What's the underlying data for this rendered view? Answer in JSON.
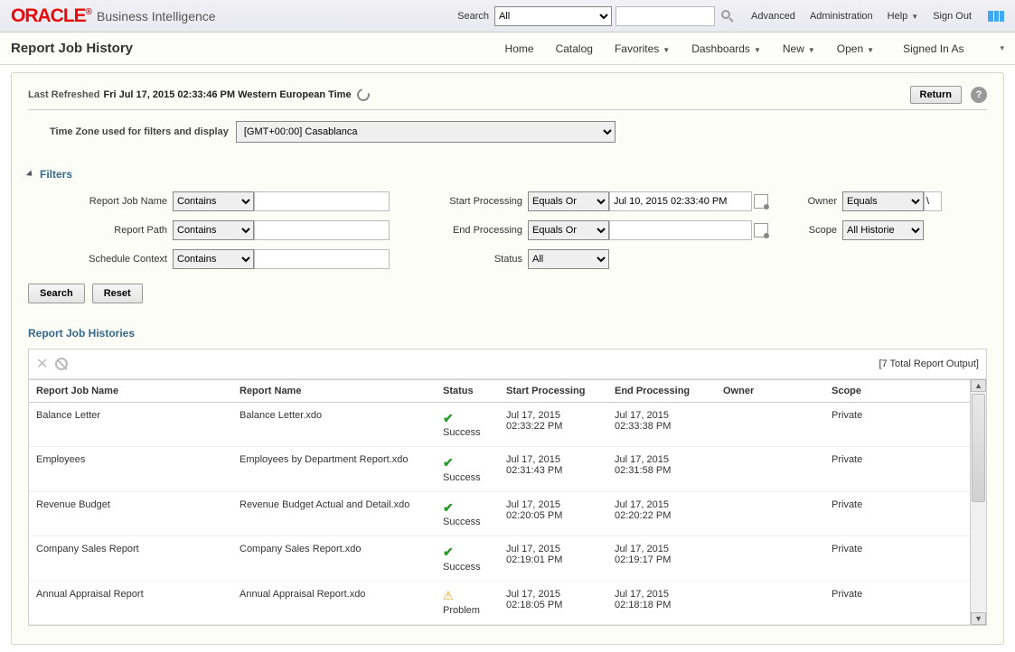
{
  "brand": {
    "oracle": "ORACLE",
    "reg": "®",
    "bi": "Business Intelligence"
  },
  "topbar": {
    "search_label": "Search",
    "search_scope": "All",
    "advanced": "Advanced",
    "administration": "Administration",
    "help": "Help",
    "signout": "Sign Out"
  },
  "subnav": {
    "page_title": "Report Job History",
    "home": "Home",
    "catalog": "Catalog",
    "favorites": "Favorites",
    "dashboards": "Dashboards",
    "new": "New",
    "open": "Open",
    "signed_in": "Signed In As"
  },
  "panel": {
    "last_refreshed_label": "Last Refreshed",
    "last_refreshed_value": "Fri Jul 17, 2015 02:33:46 PM Western European Time",
    "return": "Return",
    "tz_label": "Time Zone used for filters and display",
    "tz_value": "[GMT+00:00] Casablanca",
    "filters_title": "Filters"
  },
  "filters": {
    "report_job_name_label": "Report Job Name",
    "report_path_label": "Report Path",
    "schedule_context_label": "Schedule Context",
    "start_processing_label": "Start Processing",
    "end_processing_label": "End Processing",
    "status_label": "Status",
    "owner_label": "Owner",
    "scope_label": "Scope",
    "contains": "Contains",
    "equals_or": "Equals Or",
    "equals": "Equals",
    "status_all": "All",
    "scope_value": "All Historie",
    "start_value": "Jul 10, 2015 02:33:40 PM",
    "end_value": "",
    "owner_value": "\\",
    "search_btn": "Search",
    "reset_btn": "Reset"
  },
  "histories": {
    "title": "Report Job Histories",
    "total": "[7 Total Report Output]",
    "columns": {
      "job_name": "Report Job Name",
      "report_name": "Report Name",
      "status": "Status",
      "start": "Start Processing",
      "end": "End Processing",
      "owner": "Owner",
      "scope": "Scope"
    },
    "status_success": "Success",
    "status_problem": "Problem",
    "rows": [
      {
        "job": "Balance Letter",
        "report": "Balance Letter.xdo",
        "status": "Success",
        "start1": "Jul 17, 2015",
        "start2": "02:33:22 PM",
        "end1": "Jul 17, 2015",
        "end2": "02:33:38 PM",
        "owner": "",
        "scope": "Private"
      },
      {
        "job": "Employees",
        "report": "Employees by Department Report.xdo",
        "status": "Success",
        "start1": "Jul 17, 2015",
        "start2": "02:31:43 PM",
        "end1": "Jul 17, 2015",
        "end2": "02:31:58 PM",
        "owner": "",
        "scope": "Private"
      },
      {
        "job": "Revenue Budget",
        "report": "Revenue Budget Actual and Detail.xdo",
        "status": "Success",
        "start1": "Jul 17, 2015",
        "start2": "02:20:05 PM",
        "end1": "Jul 17, 2015",
        "end2": "02:20:22 PM",
        "owner": "",
        "scope": "Private"
      },
      {
        "job": "Company Sales Report",
        "report": "Company Sales Report.xdo",
        "status": "Success",
        "start1": "Jul 17, 2015",
        "start2": "02:19:01 PM",
        "end1": "Jul 17, 2015",
        "end2": "02:19:17 PM",
        "owner": "",
        "scope": "Private"
      },
      {
        "job": "Annual Appraisal Report",
        "report": "Annual Appraisal Report.xdo",
        "status": "Problem",
        "start1": "Jul 17, 2015",
        "start2": "02:18:05 PM",
        "end1": "Jul 17, 2015",
        "end2": "02:18:18 PM",
        "owner": "",
        "scope": "Private"
      }
    ]
  }
}
